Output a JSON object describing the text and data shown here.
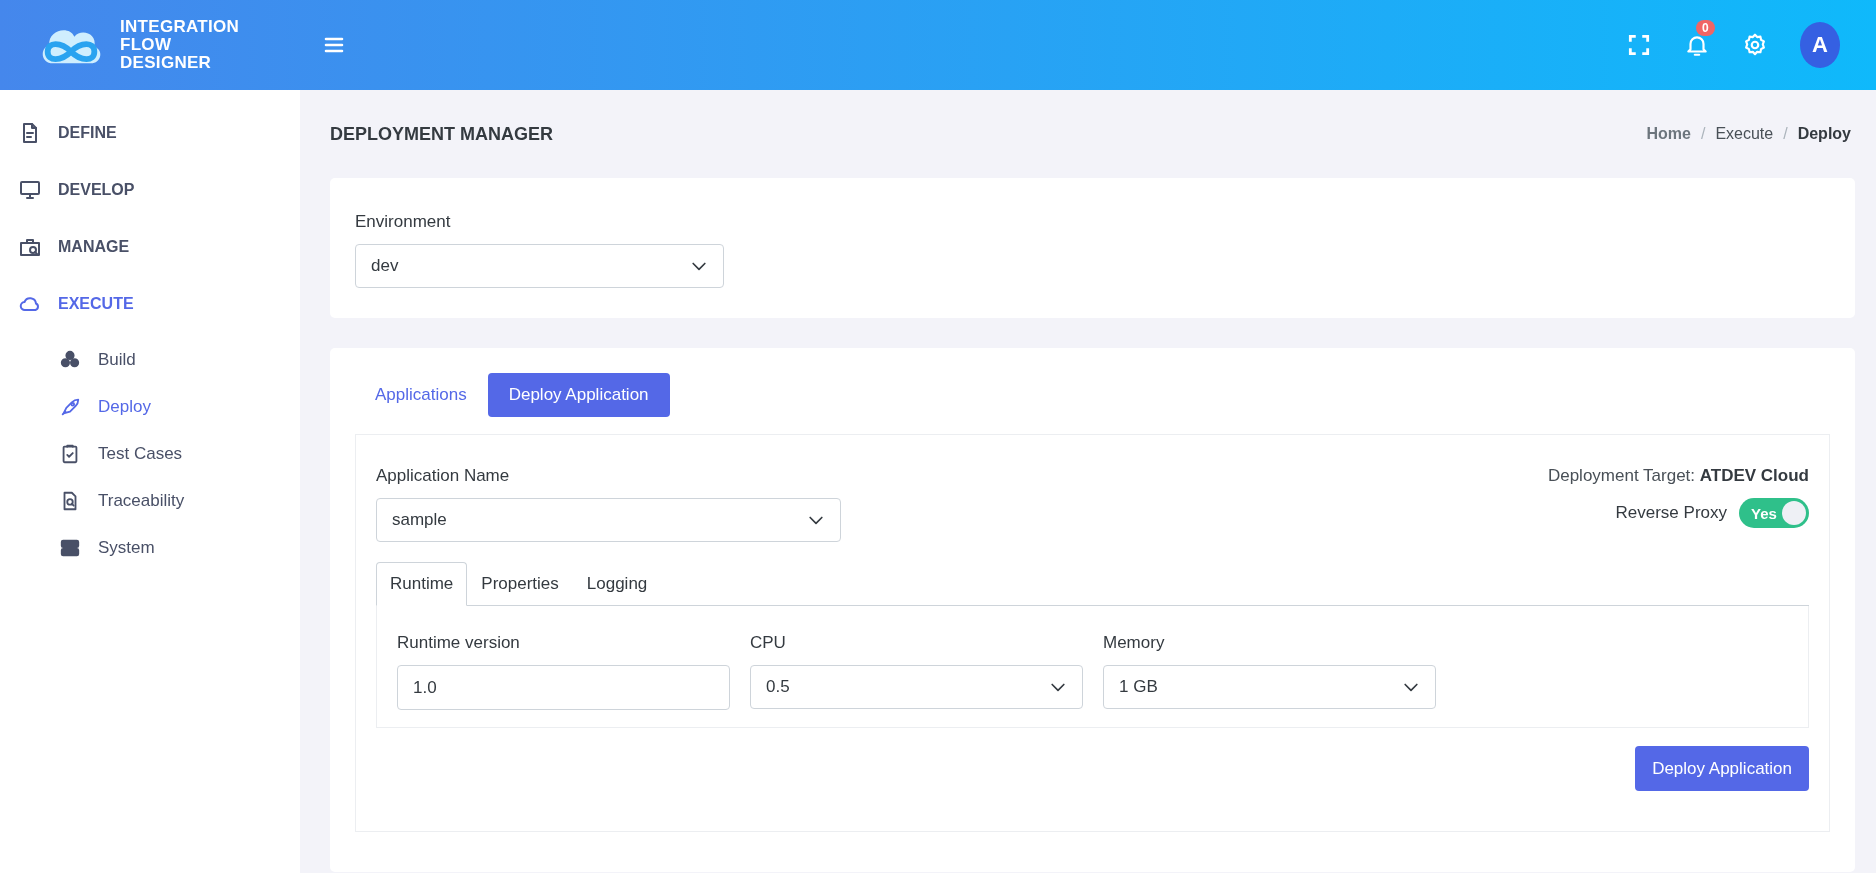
{
  "header": {
    "logo_lines": [
      "INTEGRATION",
      "FLOW",
      "DESIGNER"
    ],
    "notification_count": "0",
    "avatar_letter": "A"
  },
  "sidebar": {
    "items": [
      {
        "label": "DEFINE",
        "selected": false
      },
      {
        "label": "DEVELOP",
        "selected": false
      },
      {
        "label": "MANAGE",
        "selected": false
      },
      {
        "label": "EXECUTE",
        "selected": true,
        "children": [
          {
            "label": "Build",
            "selected": false
          },
          {
            "label": "Deploy",
            "selected": true
          },
          {
            "label": "Test Cases",
            "selected": false
          },
          {
            "label": "Traceability",
            "selected": false
          },
          {
            "label": "System",
            "selected": false
          }
        ]
      }
    ]
  },
  "page_title": "DEPLOYMENT MANAGER",
  "breadcrumb": [
    {
      "label": "Home",
      "kind": "link"
    },
    {
      "label": "Execute",
      "kind": "text",
      "separator": "/"
    },
    {
      "label": "Deploy",
      "kind": "current",
      "separator": "/"
    }
  ],
  "environment": {
    "label": "Environment",
    "value": "dev"
  },
  "tabs": [
    {
      "label": "Applications",
      "selected": false
    },
    {
      "label": "Deploy Application",
      "selected": true
    }
  ],
  "application_name": {
    "label": "Application Name",
    "value": "sample"
  },
  "deployment_target": "Deployment Target: **ATDEV Cloud**",
  "reverse_proxy": {
    "label": "Reverse Proxy",
    "on": true,
    "text": "Yes"
  },
  "sub_tabs": [
    {
      "label": "Runtime",
      "selected": true
    },
    {
      "label": "Properties",
      "selected": false
    },
    {
      "label": "Logging",
      "selected": false
    }
  ],
  "fields": [
    {
      "label": "Runtime version",
      "value": "1.0",
      "kind": "input"
    },
    {
      "label": "CPU",
      "value": "0.5",
      "kind": "select"
    },
    {
      "label": "Memory",
      "value": "1 GB",
      "kind": "select"
    }
  ],
  "deploy_button": "Deploy Application"
}
